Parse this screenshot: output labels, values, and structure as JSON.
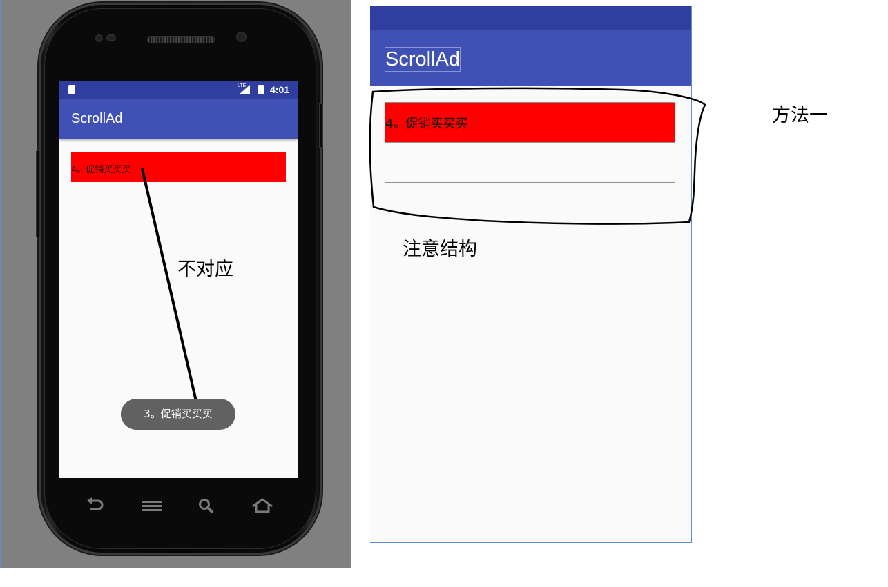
{
  "emulator": {
    "status_time": "4:01",
    "status_network": "LTE",
    "app_title": "ScrollAd",
    "ad_text": "4。促销买买买",
    "toast_text": "3。促销买买买"
  },
  "layout_preview": {
    "app_title": "ScrollAd",
    "ad_text": "4。促销买买买"
  },
  "annotations": {
    "mismatch": "不对应",
    "method": "方法一",
    "note_structure": "注意结构"
  },
  "colors": {
    "status_bar": "#303f9f",
    "app_bar": "#3f51b5",
    "ad_background": "#ff0000",
    "toast": "#616161",
    "screen_background": "#fafafa"
  },
  "icons": [
    "sd-card-icon",
    "signal-icon",
    "battery-icon",
    "back-icon",
    "menu-icon",
    "search-icon",
    "home-icon"
  ]
}
